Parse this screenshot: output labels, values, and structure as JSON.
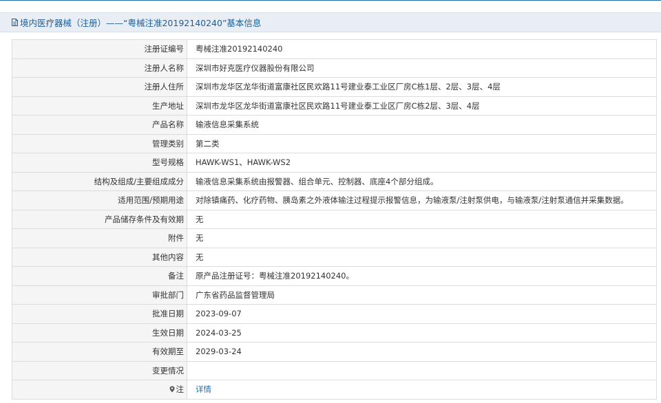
{
  "header": {
    "title": "境内医疗器械（注册）——“粤械注准20192140240”基本信息",
    "icon": "document-icon"
  },
  "colors": {
    "header_text": "#1a5d9a",
    "header_bg": "#e9eef4",
    "label_bg": "#f5f5f5",
    "link": "#1f6fb2"
  },
  "rows": [
    {
      "label": "注册证编号",
      "value": "粤械注准20192140240"
    },
    {
      "label": "注册人名称",
      "value": "深圳市好克医疗仪器股份有限公司"
    },
    {
      "label": "注册人住所",
      "value": "深圳市龙华区龙华街道富康社区民欢路11号建业泰工业区厂房C栋1层、2层、3层、4层"
    },
    {
      "label": "生产地址",
      "value": "深圳市龙华区龙华街道富康社区民欢路11号建业泰工业区厂房C栋2层、3层、4层"
    },
    {
      "label": "产品名称",
      "value": "输液信息采集系统"
    },
    {
      "label": "管理类别",
      "value": "第二类"
    },
    {
      "label": "型号规格",
      "value": "HAWK-WS1、HAWK-WS2"
    },
    {
      "label": "结构及组成/主要组成成分",
      "value": "输液信息采集系统由报警器、组合单元、控制器、底座4个部分组成。"
    },
    {
      "label": "适用范围/预期用途",
      "value": "对除镇痛药、化疗药物、胰岛素之外液体输注过程提示报警信息，为输液泵/注射泵供电，与输液泵/注射泵通信并采集数据。"
    },
    {
      "label": "产品储存条件及有效期",
      "value": "无"
    },
    {
      "label": "附件",
      "value": "无"
    },
    {
      "label": "其他内容",
      "value": "无"
    },
    {
      "label": "备注",
      "value": "原产品注册证号：粤械注准20192140240。"
    },
    {
      "label": "审批部门",
      "value": "广东省药品监督管理局"
    },
    {
      "label": "批准日期",
      "value": "2023-09-07"
    },
    {
      "label": "生效日期",
      "value": "2024-03-25"
    },
    {
      "label": "有效期至",
      "value": "2029-03-24"
    },
    {
      "label": "变更情况",
      "value": ""
    }
  ],
  "note_row": {
    "label": "注",
    "icon": "pin-icon",
    "link_text": "详情"
  }
}
